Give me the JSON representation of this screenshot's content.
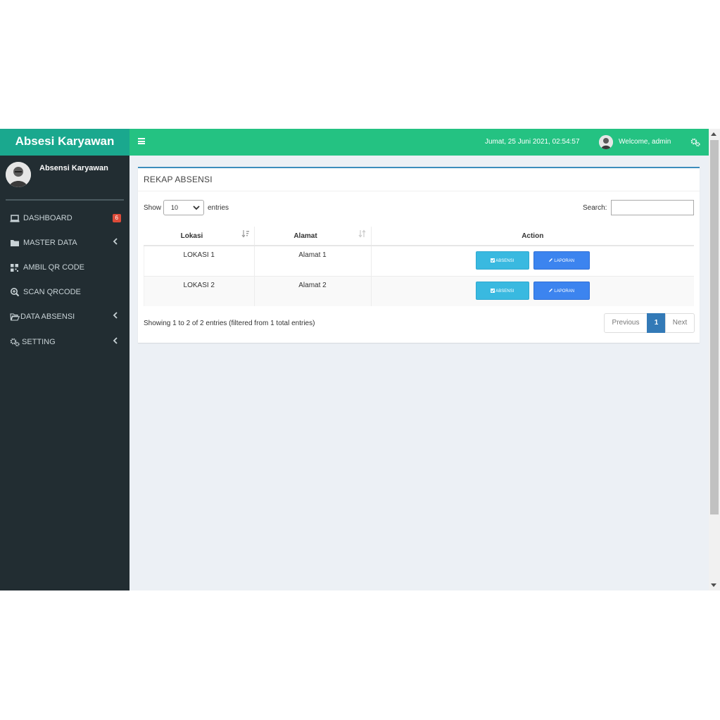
{
  "sidebar": {
    "brand": "Absesi Karyawan",
    "user_name": "Absensi Karyawan",
    "menu": [
      {
        "label": "DASHBOARD",
        "badge": "6"
      },
      {
        "label": "MASTER DATA"
      },
      {
        "label": "AMBIL QR CODE"
      },
      {
        "label": "SCAN QRCODE"
      },
      {
        "label": "DATA ABSENSI"
      },
      {
        "label": "SETTING"
      }
    ]
  },
  "topbar": {
    "datetime": "Jumat, 25 Juni 2021, 02:54:57",
    "welcome": "Welcome, admin"
  },
  "box": {
    "title": "REKAP ABSENSI",
    "show_label": "Show",
    "entries_label": "entries",
    "length_value": "10",
    "search_label": "Search:",
    "search_value": "",
    "columns": [
      "Lokasi",
      "Alamat",
      "Action"
    ],
    "rows": [
      {
        "lokasi": "LOKASI 1",
        "alamat": "Alamat 1"
      },
      {
        "lokasi": "LOKASI 2",
        "alamat": "Alamat 2"
      }
    ],
    "btn_absensi": "ABSENSI",
    "btn_laporan": "LAPORAN",
    "info": "Showing 1 to 2 of 2 entries (filtered from 1 total entries)",
    "pager": {
      "previous": "Previous",
      "page": "1",
      "next": "Next"
    }
  },
  "colors": {
    "topbar": "#24c282",
    "brand": "#1aa88e",
    "sidebar": "#222d32",
    "btn_absensi": "#39b9e0",
    "btn_laporan": "#3c84ef",
    "badge": "#dd4b39"
  }
}
